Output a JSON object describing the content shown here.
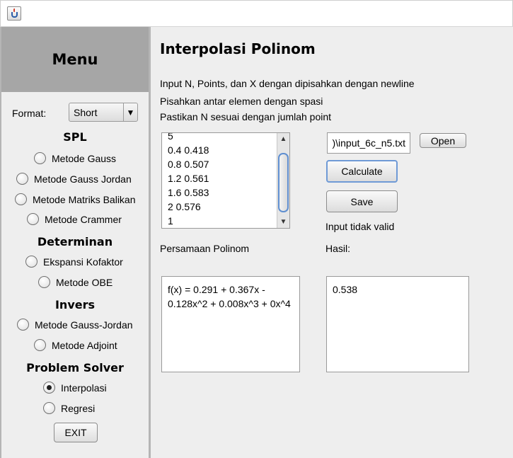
{
  "sidebar": {
    "menu_title": "Menu",
    "format_label": "Format:",
    "format_value": "Short",
    "groups": {
      "spl": "SPL",
      "determinan": "Determinan",
      "invers": "Invers",
      "problem_solver": "Problem Solver"
    },
    "options": {
      "metode_gauss": "Metode Gauss",
      "metode_gauss_jordan": "Metode Gauss Jordan",
      "metode_matriks_balikan": "Metode Matriks Balikan",
      "metode_crammer": "Metode Crammer",
      "ekspansi_kofaktor": "Ekspansi Kofaktor",
      "metode_obe": "Metode OBE",
      "invers_gauss_jordan": "Metode Gauss-Jordan",
      "metode_adjoint": "Metode Adjoint",
      "interpolasi": "Interpolasi",
      "regresi": "Regresi"
    },
    "selected_option": "interpolasi",
    "exit_label": "EXIT"
  },
  "main": {
    "title": "Interpolasi Polinom",
    "instructions": [
      "Input N, Points, dan X dengan dipisahkan dengan newline",
      "Pisahkan antar elemen dengan spasi",
      "Pastikan N sesuai dengan jumlah point"
    ],
    "input_lines": [
      "5",
      "0.4 0.418",
      "0.8 0.507",
      "1.2 0.561",
      "1.6 0.583",
      "2 0.576",
      "1"
    ],
    "file_path": ")\\input_6c_n5.txt",
    "open_label": "Open",
    "calculate_label": "Calculate",
    "save_label": "Save",
    "status_text": "Input tidak valid",
    "persamaan_label": "Persamaan Polinom",
    "hasil_label": "Hasil:",
    "persamaan_lines": [
      "f(x) = 0.291 + 0.367x -",
      "0.128x^2 + 0.008x^3 + 0x^4"
    ],
    "hasil_value": "0.538"
  }
}
